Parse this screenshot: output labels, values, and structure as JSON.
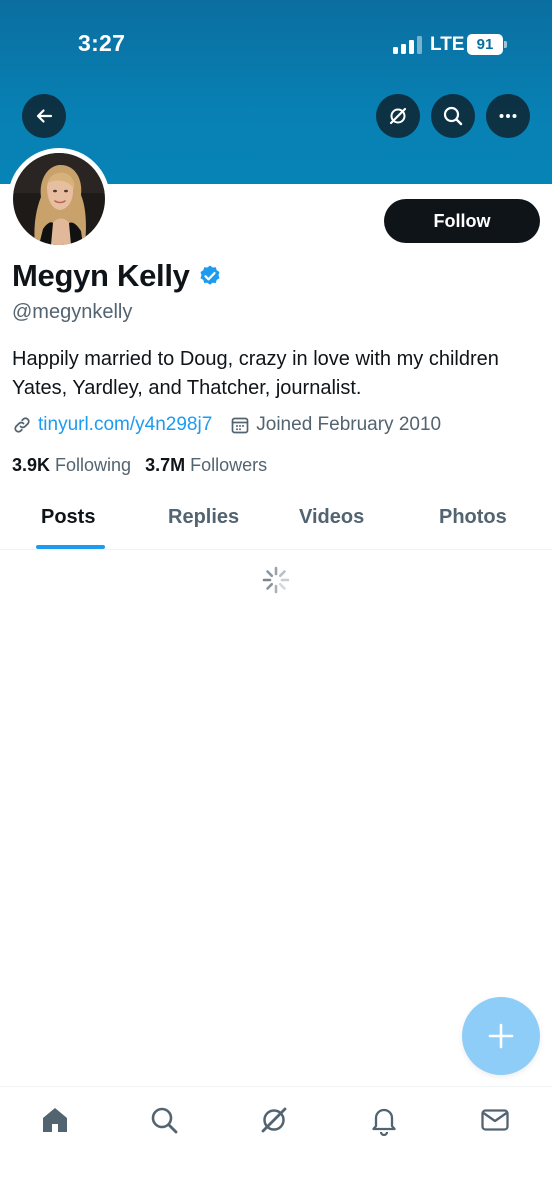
{
  "status_bar": {
    "time": "3:27",
    "network": "LTE",
    "battery": "91"
  },
  "header": {
    "back_icon": "arrow-left-icon",
    "actions": [
      "grok-icon",
      "search-icon",
      "more-icon"
    ]
  },
  "profile": {
    "name": "Megyn Kelly",
    "verified_icon": "verified-badge-icon",
    "handle": "@megynkelly",
    "bio": "Happily married to Doug, crazy in love with my children Yates, Yardley, and Thatcher, journalist.",
    "link": "tinyurl.com/y4n298j7",
    "joined": "Joined February 2010",
    "following_count": "3.9K",
    "following_label": "Following",
    "followers_count": "3.7M",
    "followers_label": "Followers",
    "follow_label": "Follow"
  },
  "tabs": [
    {
      "label": "Posts",
      "active": true
    },
    {
      "label": "Replies",
      "active": false
    },
    {
      "label": "Videos",
      "active": false
    },
    {
      "label": "Photos",
      "active": false
    }
  ],
  "bottom_nav": [
    "home-icon",
    "search-icon",
    "grok-icon",
    "notifications-icon",
    "messages-icon"
  ],
  "colors": {
    "accent": "#1d9bf0",
    "banner": "#0880b3",
    "follow_button": "#0f1419",
    "fab": "#8ecdf8"
  }
}
